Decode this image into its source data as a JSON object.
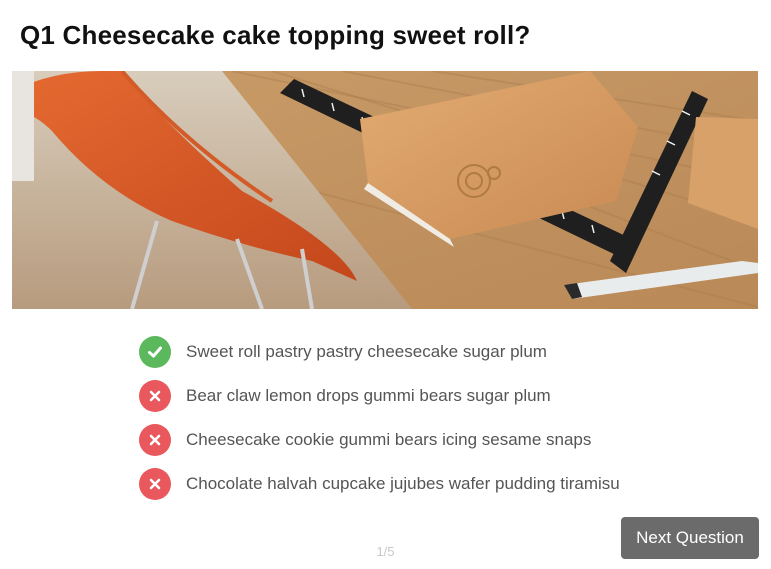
{
  "quiz": {
    "question_number": "Q1",
    "question_text": "Cheesecake cake topping sweet roll?"
  },
  "answers": [
    {
      "text": "Sweet roll pastry pastry cheesecake sugar plum",
      "status": "correct",
      "icon": "check-icon"
    },
    {
      "text": "Bear claw lemon drops gummi bears sugar plum",
      "status": "incorrect",
      "icon": "close-icon"
    },
    {
      "text": "Cheesecake cookie gummi bears icing sesame snaps",
      "status": "incorrect",
      "icon": "close-icon"
    },
    {
      "text": "Chocolate halvah cupcake jujubes wafer pudding tiramisu",
      "status": "incorrect",
      "icon": "close-icon"
    }
  ],
  "pager": {
    "text": "1/5"
  },
  "buttons": {
    "next_label": "Next Question"
  },
  "colors": {
    "correct": "#5cb85c",
    "incorrect": "#e8585c",
    "button": "#6b6b6b"
  }
}
